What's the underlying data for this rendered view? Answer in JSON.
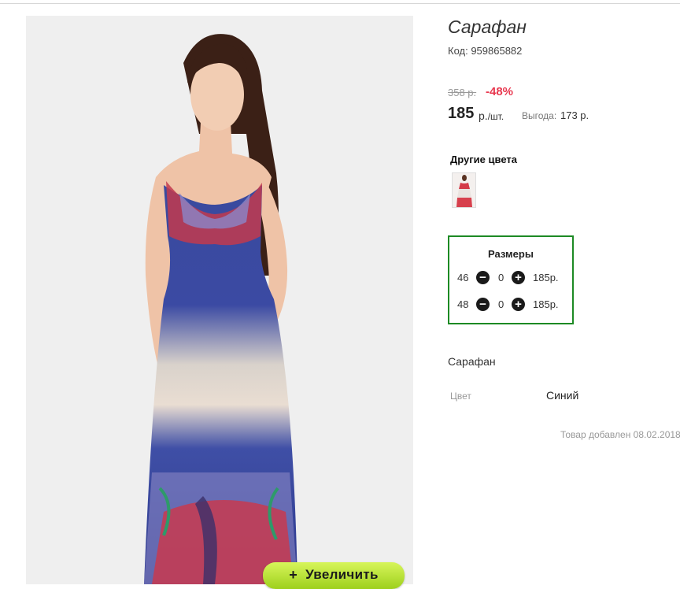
{
  "product": {
    "title": "Сарафан",
    "code": "Код: 959865882",
    "old_price": "358 р.",
    "discount": "-48%",
    "price": "185",
    "price_unit": "р.",
    "price_per": "/шт.",
    "savings_label": "Выгода:",
    "savings_value": "173 р.",
    "description": "Сарафан",
    "added": "Товар добавлен 08.02.2018"
  },
  "gallery": {
    "zoom_label": "Увеличить",
    "zoom_icon": "+",
    "image_description": "Model in blue and white ombre maxi halter dress with red paisley print"
  },
  "other_colors": {
    "title": "Другие цвета",
    "thumbnails": [
      {
        "icon": "dress-thumbnail-red"
      }
    ]
  },
  "sizes": {
    "title": "Размеры",
    "rows": [
      {
        "size": "46",
        "qty": "0",
        "price": "185р."
      },
      {
        "size": "48",
        "qty": "0",
        "price": "185р."
      }
    ]
  },
  "attributes": [
    {
      "label": "Цвет",
      "value": "Синий"
    }
  ],
  "colors": {
    "discount": "#e8384f",
    "sizes_border": "#1d8a24",
    "zoom_button": "#b5e236"
  }
}
